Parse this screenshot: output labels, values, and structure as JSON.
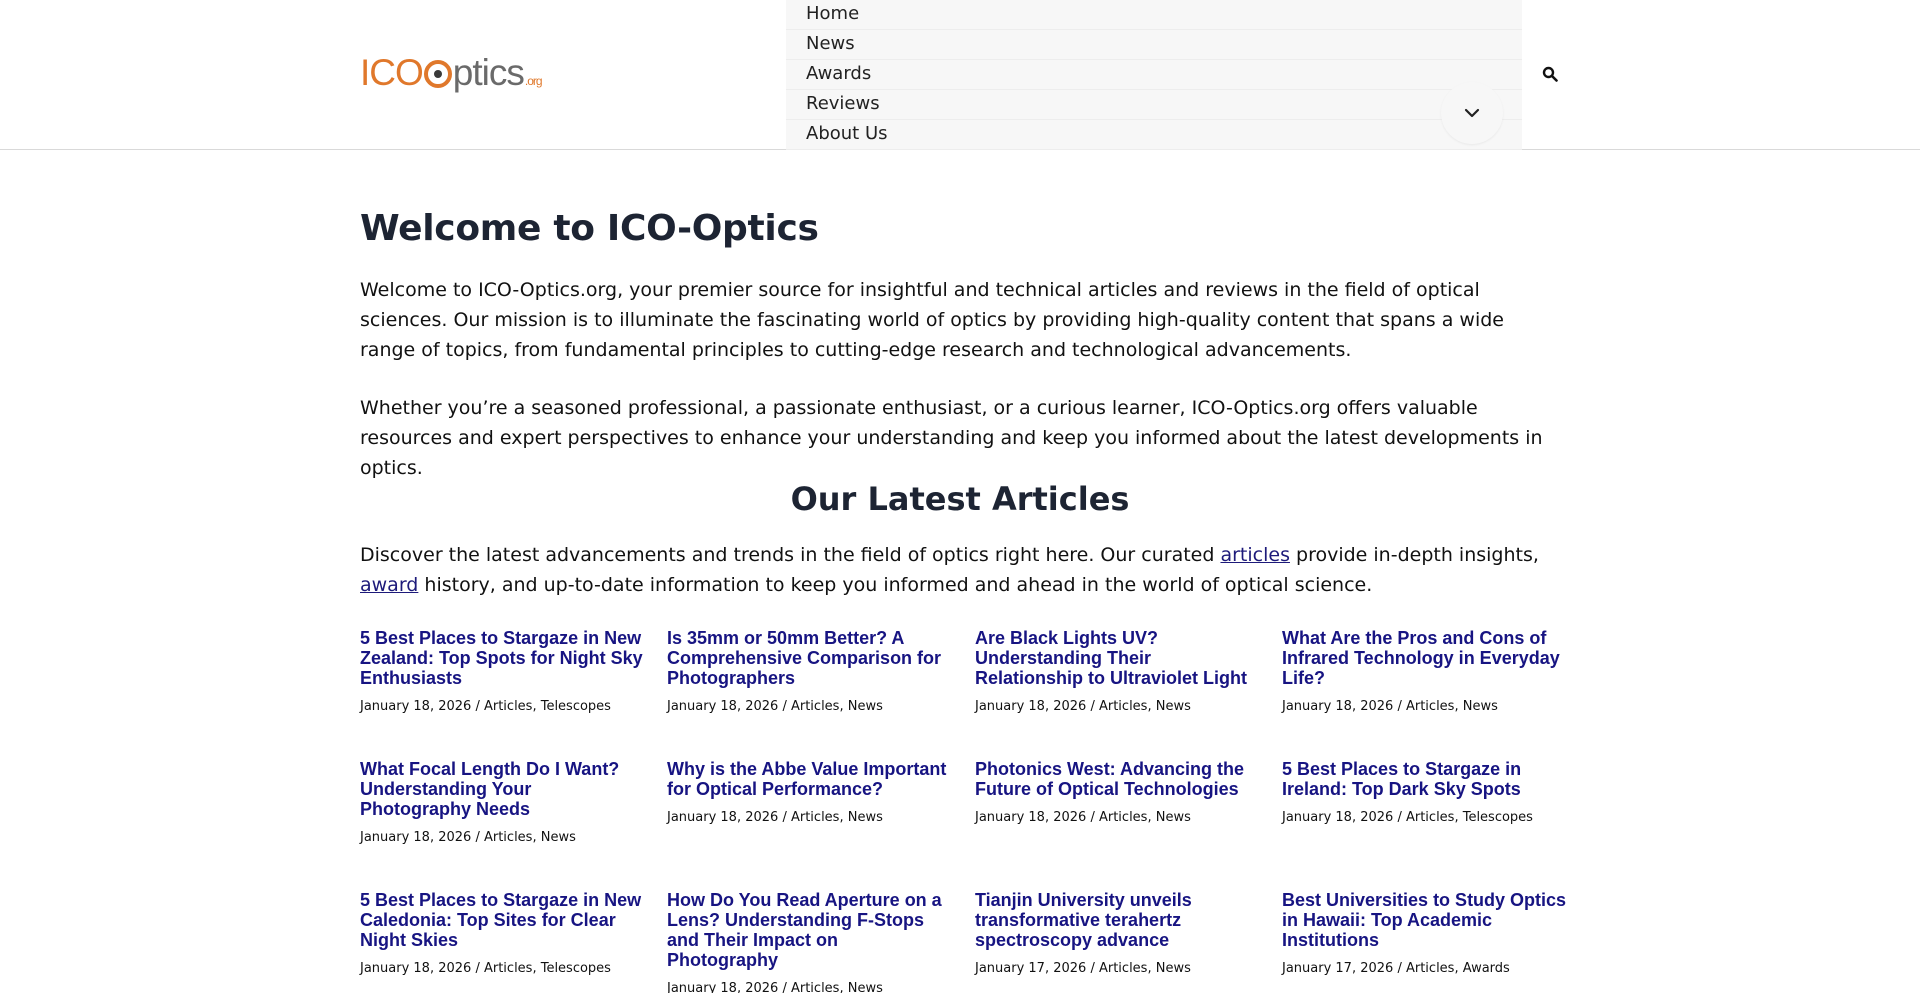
{
  "header": {
    "logo": {
      "ico": "ICO",
      "optics": "ptics",
      "org": ".org"
    },
    "nav": [
      "Home",
      "News",
      "Awards",
      "Reviews",
      "About Us"
    ],
    "icons": {
      "toggle": "chevron-down-icon",
      "search": "search-icon"
    }
  },
  "main": {
    "title": "Welcome to ICO-Optics",
    "intro": "Welcome to ICO-Optics.org, your premier source for insightful and technical articles and reviews in the field of optical sciences. Our mission is to illuminate the fascinating world of optics by providing high-quality content that spans a wide range of topics, from fundamental principles to cutting-edge research and technological advancements.",
    "intro2": "Whether you’re a seasoned professional, a passionate enthusiast, or a curious learner, ICO-Optics.org offers valuable resources and expert perspectives to enhance your understanding and keep you informed about the latest developments in optics.",
    "latest_title": "Our Latest Articles",
    "latest_intro": {
      "before": "Discover the latest advancements and trends in the field of optics right here. Our curated ",
      "link1": "articles",
      "middle": " provide in-depth insights, ",
      "link2": "award",
      "after": " history, and up-to-date information to keep you informed and ahead in the world of optical science."
    },
    "articles": [
      {
        "title": "5 Best Places to Stargaze in New Zealand: Top Spots for Night Sky Enthusiasts",
        "date": "January 18, 2026",
        "cat1": "Articles",
        "cat2": "Telescopes"
      },
      {
        "title": "Is 35mm or 50mm Better? A Comprehensive Comparison for Photographers",
        "date": "January 18, 2026",
        "cat1": "Articles",
        "cat2": "News"
      },
      {
        "title": "Are Black Lights UV? Understanding Their Relationship to Ultraviolet Light",
        "date": "January 18, 2026",
        "cat1": "Articles",
        "cat2": "News"
      },
      {
        "title": "What Are the Pros and Cons of Infrared Technology in Everyday Life?",
        "date": "January 18, 2026",
        "cat1": "Articles",
        "cat2": "News"
      },
      {
        "title": "What Focal Length Do I Want? Understanding Your Photography Needs",
        "date": "January 18, 2026",
        "cat1": "Articles",
        "cat2": "News"
      },
      {
        "title": "Why is the Abbe Value Important for Optical Performance?",
        "date": "January 18, 2026",
        "cat1": "Articles",
        "cat2": "News"
      },
      {
        "title": "Photonics West: Advancing the Future of Optical Technologies",
        "date": "January 18, 2026",
        "cat1": "Articles",
        "cat2": "News"
      },
      {
        "title": "5 Best Places to Stargaze in Ireland: Top Dark Sky Spots",
        "date": "January 18, 2026",
        "cat1": "Articles",
        "cat2": "Telescopes"
      },
      {
        "title": "5 Best Places to Stargaze in New Caledonia: Top Sites for Clear Night Skies",
        "date": "January 18, 2026",
        "cat1": "Articles",
        "cat2": "Telescopes"
      },
      {
        "title": "How Do You Read Aperture on a Lens? Understanding F-Stops and Their Impact on Photography",
        "date": "January 18, 2026",
        "cat1": "Articles",
        "cat2": "News"
      },
      {
        "title": "Tianjin University unveils transformative terahertz spectroscopy advance",
        "date": "January 17, 2026",
        "cat1": "Articles",
        "cat2": "News"
      },
      {
        "title": "Best Universities to Study Optics in Hawaii: Top Academic Institutions",
        "date": "January 17, 2026",
        "cat1": "Articles",
        "cat2": "Awards"
      }
    ]
  }
}
